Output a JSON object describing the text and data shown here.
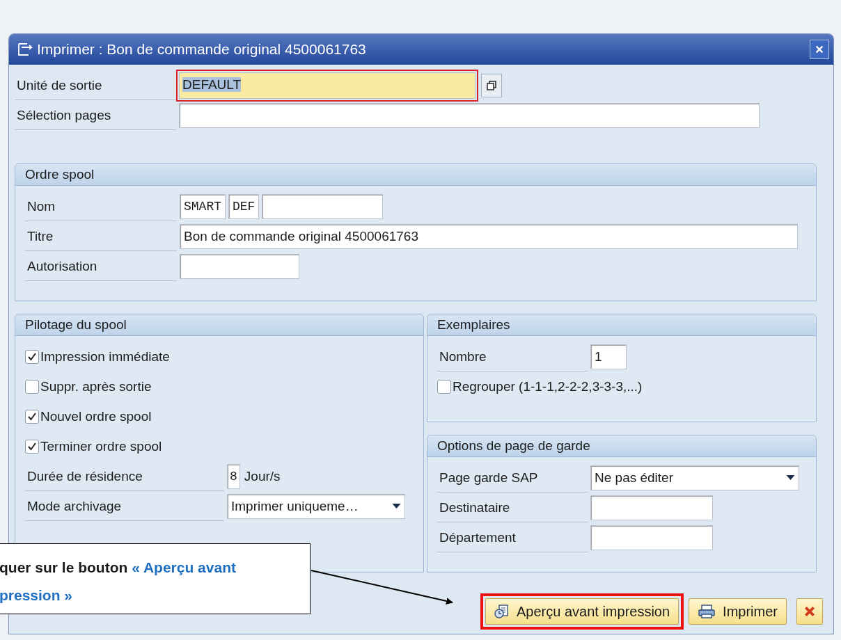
{
  "window": {
    "title": "Imprimer : Bon de commande original 4500061763"
  },
  "output_device": {
    "label": "Unité de sortie",
    "value": "DEFAULT",
    "focused": true
  },
  "page_selection": {
    "label": "Sélection pages"
  },
  "spool_request": {
    "title": "Ordre spool",
    "name": {
      "label": "Nom",
      "values": [
        "SMART",
        "DEF"
      ]
    },
    "title_field": {
      "label": "Titre",
      "value": "Bon de commande original 4500061763"
    },
    "authorization": {
      "label": "Autorisation"
    }
  },
  "spool_control": {
    "title": "Pilotage du spool",
    "options": [
      {
        "label": "Impression immédiate",
        "checked": true
      },
      {
        "label": "Suppr. après sortie",
        "checked": false
      },
      {
        "label": "Nouvel ordre spool",
        "checked": true
      },
      {
        "label": "Terminer ordre spool",
        "checked": true
      }
    ],
    "retention": {
      "label": "Durée de résidence",
      "value": "8",
      "unit": "Jour/s"
    },
    "archive_mode": {
      "label": "Mode archivage",
      "value": "Imprimer uniqueme…"
    }
  },
  "copies": {
    "title": "Exemplaires",
    "number": {
      "label": "Nombre",
      "value": "1"
    },
    "collate": {
      "label": "Regrouper (1-1-1,2-2-2,3-3-3,...)",
      "checked": false
    }
  },
  "cover_page": {
    "title": "Options de page de garde",
    "sap_cover": {
      "label": "Page garde SAP",
      "value": "Ne pas éditer"
    },
    "recipient": {
      "label": "Destinataire"
    },
    "department": {
      "label": "Département"
    }
  },
  "buttons": [
    {
      "kind": "preview",
      "label": "Aperçu avant impression",
      "highlighted": true
    },
    {
      "kind": "print",
      "label": "Imprimer",
      "highlighted": false
    },
    {
      "kind": "cancel",
      "highlighted": false
    }
  ],
  "callout": {
    "lines": [
      [
        {
          "text": "quer sur le bouton ",
          "accent": false
        },
        {
          "text": "« Aperçu avant",
          "accent": true
        }
      ],
      [
        {
          "text": "pression »",
          "accent": true
        }
      ]
    ]
  }
}
